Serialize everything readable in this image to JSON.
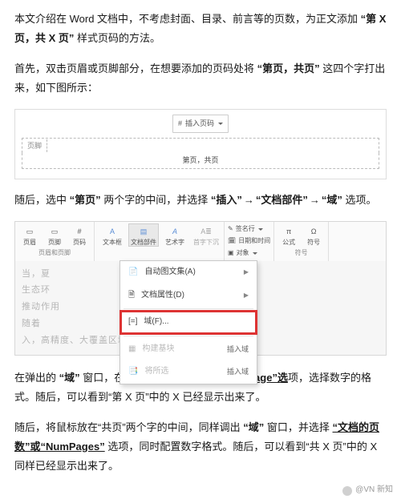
{
  "p1": {
    "t1": "本文介绍在 Word 文档中，不考虑封面、目录、前言等的页数，为正文添加 ",
    "b1": "“第 X 页，共 X 页”",
    "t2": " 样式页码的方法。"
  },
  "p2": {
    "t1": "首先，双击页眉或页脚部分，在想要添加的页码处将 ",
    "b1": "“第页，共页”",
    "t2": " 这四个字打出来，如下图所示："
  },
  "hf": {
    "tooltip_icon": "#",
    "tooltip_label": "插入页码",
    "top_label": "页脚",
    "bottom_text": "第页，共页"
  },
  "p3": {
    "t1": "随后，选中 ",
    "b1": "“第页”",
    "t2": " 两个字的中间，并选择 ",
    "b2": "“插入”",
    "arrow": "→",
    "b3": "“文档部件”",
    "b4": "“域”",
    "t3": " 选项。"
  },
  "ribbon": {
    "g1": {
      "b1": "页眉",
      "b2": "页脚",
      "b3": "页码",
      "name": "页眉和页脚"
    },
    "g2": {
      "b1": "文本框",
      "b2": "文档部件",
      "b3": "艺术字",
      "b4": "首字下沉"
    },
    "g3": {
      "r1": "签名行",
      "r2": "日期和时间",
      "r3": "对象"
    },
    "g4": {
      "b1": "公式",
      "b2": "符号",
      "name": "符号"
    }
  },
  "menu": {
    "m1": {
      "icon": "📄",
      "label": "自动图文集(A)"
    },
    "m2": {
      "icon": "🗎",
      "label": "文档属性(D)"
    },
    "m3": {
      "icon": "[=]",
      "label": "域(F)..."
    },
    "m4": {
      "icon": "▦",
      "label": "构建基块"
    },
    "m4b": "插入域",
    "m5": {
      "icon": "📑",
      "label": "将所选"
    },
    "m5b": "插入域"
  },
  "blur": {
    "l1": "当，夏　　　　　　　　　　　　　相天研究其有至",
    "l2": "生态环　　　　　　　　　　　　　或研究由定性到",
    "l3": "推动作用　　　　　　　　　　　　　　　　　　　",
    "l4": "随着　　　　　　　　　　　　大尺度空间范围",
    "l5": "入，高精度、大覆盖区域的数据来源逐渐成为研究中"
  },
  "p4": {
    "t1": "在弹出的 ",
    "b1": "“域”",
    "t2": " 窗口，在域名中选择 ",
    "u1": "“当前页码”或“Page”选",
    "t3": "项，选择数字的格式。随后，可以看到“第 X 页”中的 X 已经显示出来了。"
  },
  "p5": {
    "t1": "随后，将鼠标放在“共页”两个字的中间，同样调出 ",
    "b1": "“域”",
    "t2": " 窗口，并选择 ",
    "u1": "“文档的页数”或“NumPages”",
    "t3": " 选项，同时配置数字格式。随后，可以看到“共 X 页”中的 X 同样已经显示出来了。"
  },
  "watermark": "@VN 新知"
}
